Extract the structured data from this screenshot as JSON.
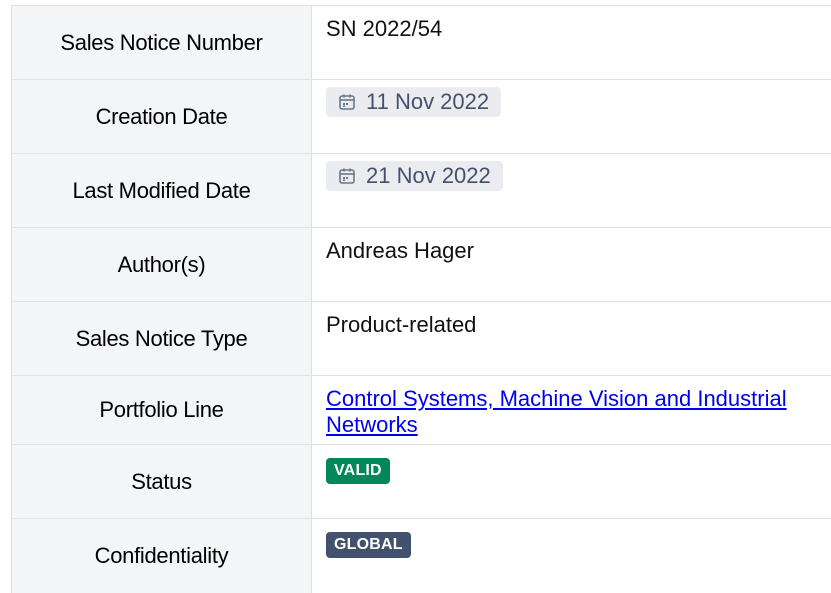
{
  "rows": {
    "sales_notice_number": {
      "label": "Sales Notice Number",
      "value": "SN 2022/54"
    },
    "creation_date": {
      "label": "Creation Date",
      "value": "11 Nov 2022"
    },
    "last_modified_date": {
      "label": "Last Modified Date",
      "value": "21 Nov 2022"
    },
    "authors": {
      "label": "Author(s)",
      "value": "Andreas Hager"
    },
    "sales_notice_type": {
      "label": "Sales Notice Type",
      "value": "Product-related"
    },
    "portfolio_line": {
      "label": "Portfolio Line",
      "value": "Control Systems, Machine Vision and Industrial Networks"
    },
    "status": {
      "label": "Status",
      "value": "VALID",
      "color": "#00875a"
    },
    "confidentiality": {
      "label": "Confidentiality",
      "value": "GLOBAL",
      "color": "#42526e"
    }
  },
  "icons": {
    "date": "calendar-icon"
  }
}
